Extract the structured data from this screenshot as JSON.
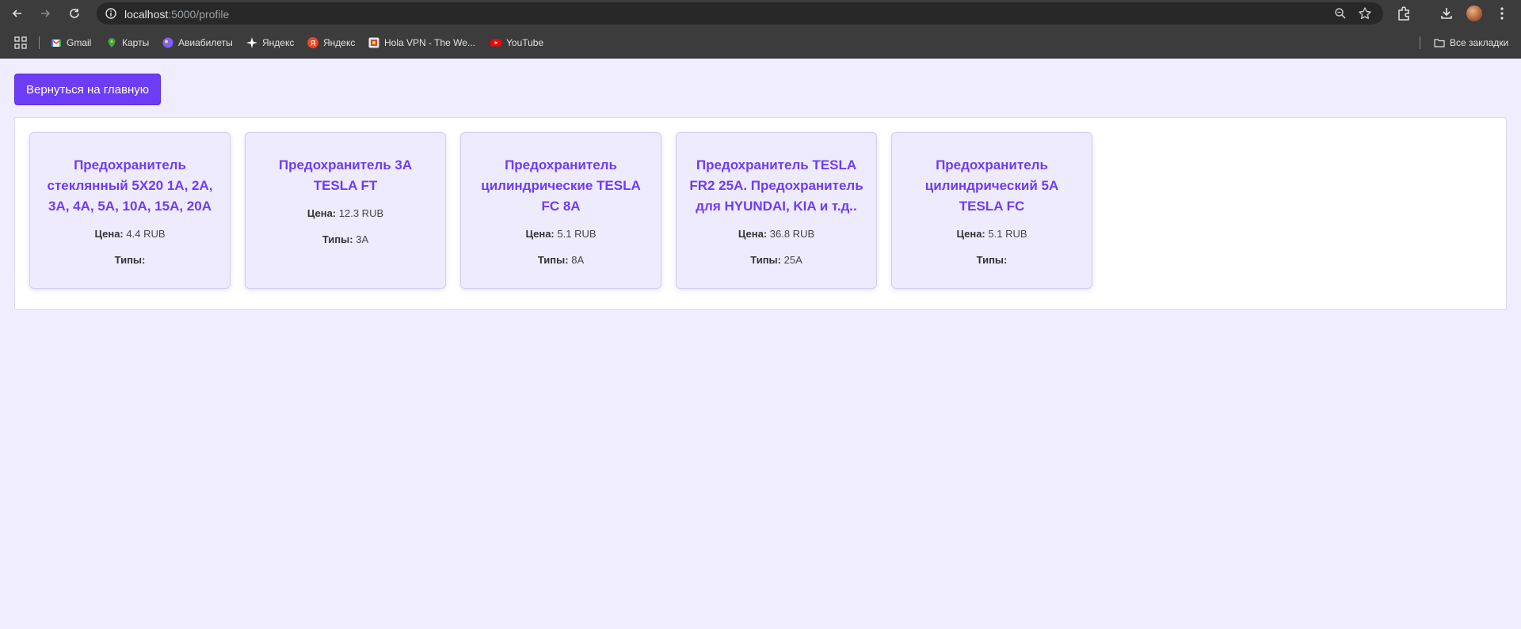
{
  "browser": {
    "url_host": "localhost",
    "url_path": ":5000/profile",
    "bookmarks": [
      {
        "label": "Gmail",
        "icon": "gmail-icon",
        "color": "#ea4335"
      },
      {
        "label": "Карты",
        "icon": "maps-icon",
        "color": "#34a853"
      },
      {
        "label": "Авиабилеты",
        "icon": "flights-icon",
        "color": "#7b61ff"
      },
      {
        "label": "Яндекс",
        "icon": "yandex-star-icon",
        "color": "#ffffff"
      },
      {
        "label": "Яндекс",
        "icon": "yandex-icon",
        "color": "#fc3f1d"
      },
      {
        "label": "Hola VPN - The We...",
        "icon": "hola-icon",
        "color": "#e8e8e8"
      },
      {
        "label": "YouTube",
        "icon": "youtube-icon",
        "color": "#ff0000"
      }
    ],
    "all_bookmarks_label": "Все закладки"
  },
  "page": {
    "back_button": "Вернуться на главную",
    "price_label": "Цена:",
    "types_label": "Типы:",
    "products": [
      {
        "title": "Предохранитель стеклянный 5Х20 1А, 2А, 3А, 4А, 5А, 10А, 15А, 20А",
        "price": "4.4 RUB",
        "types": ""
      },
      {
        "title": "Предохранитель 3A TESLA FT",
        "price": "12.3 RUB",
        "types": "3A"
      },
      {
        "title": "Предохранитель цилиндрические TESLA FC 8A",
        "price": "5.1 RUB",
        "types": "8A"
      },
      {
        "title": "Предохранитель TESLA FR2 25A. Предохранитель для HYUNDAI, KIA и т.д..",
        "price": "36.8 RUB",
        "types": "25A"
      },
      {
        "title": "Предохранитель цилиндрический 5A TESLA FC",
        "price": "5.1 RUB",
        "types": ""
      }
    ]
  },
  "colors": {
    "accent": "#6d3df5",
    "page_background": "#f0eefe",
    "card_background": "#efebfe"
  }
}
